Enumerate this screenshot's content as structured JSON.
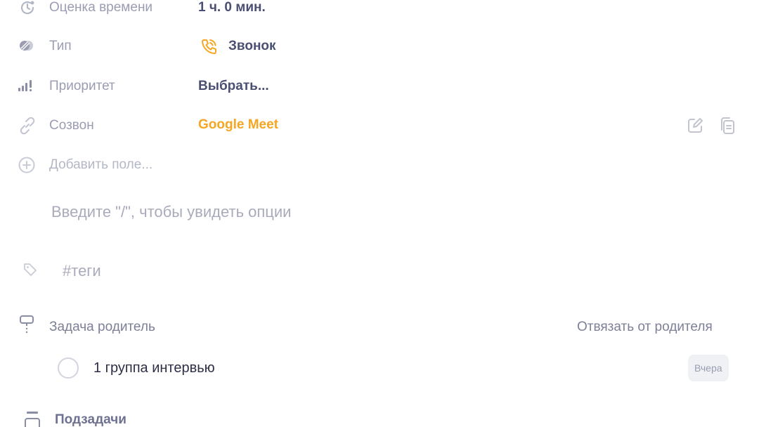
{
  "fields": [
    {
      "icon": "time-estimate-icon",
      "label": "Оценка времени",
      "value": "1 ч. 0 мин."
    },
    {
      "icon": "type-icon",
      "label": "Тип",
      "value": "Звонок",
      "value_icon": "phone-icon"
    },
    {
      "icon": "priority-icon",
      "label": "Приоритет",
      "value": "Выбрать..."
    },
    {
      "icon": "link-icon",
      "label": "Созвон",
      "value": "Google Meet"
    }
  ],
  "add_field": {
    "icon": "plus-circle-icon",
    "label": "Добавить поле..."
  },
  "editor": {
    "placeholder": "Введите \"/\", чтобы увидеть опции"
  },
  "tags": {
    "icon": "tag-icon",
    "placeholder": "#теги"
  },
  "parent": {
    "icon": "parent-task-icon",
    "title": "Задача родитель",
    "unlink_label": "Отвязать от родителя",
    "task": {
      "title": "1 группа интервью",
      "date_badge": "Вчера"
    }
  },
  "subtasks": {
    "icon": "subtasks-icon",
    "title": "Подзадачи"
  },
  "colors": {
    "accent": "#f5a623",
    "text": "#4a4f73",
    "muted": "#9a9db2"
  }
}
